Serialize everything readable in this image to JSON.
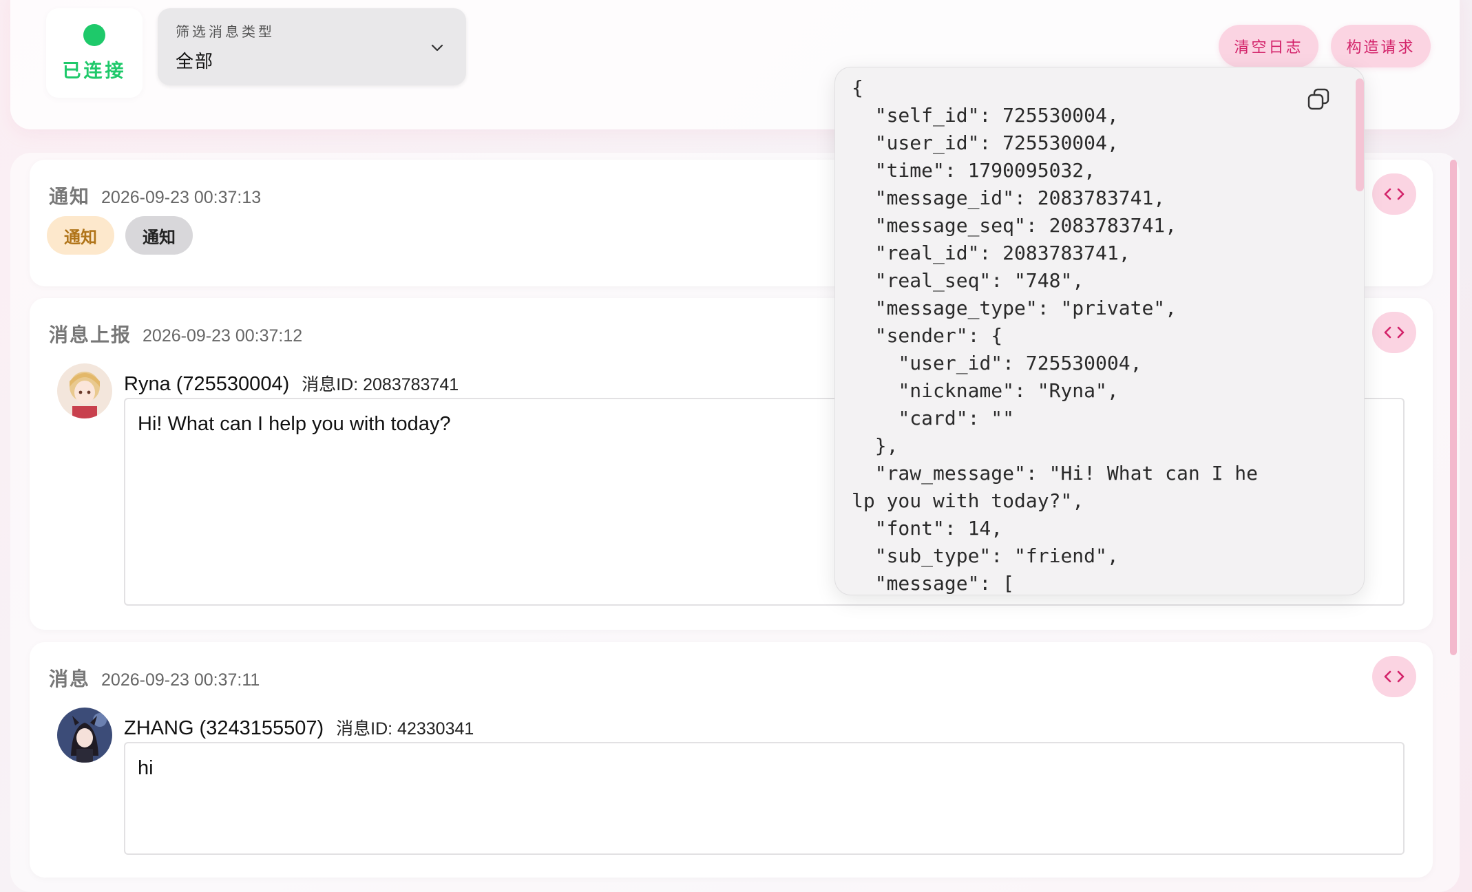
{
  "header": {
    "status": "已连接",
    "filter": {
      "label": "筛选消息类型",
      "value": "全部"
    },
    "buttons": {
      "clear_log": "清空日志",
      "build_request": "构造请求"
    }
  },
  "colors": {
    "connected": "#1ec96a",
    "accent": "#d3236a",
    "accent_bg": "#fbd4e2",
    "tag_orange_bg": "#fde8cc",
    "tag_orange_text": "#b07419"
  },
  "entries": [
    {
      "type": "通知",
      "time": "2026-09-23 00:37:13",
      "tags": [
        "通知",
        "通知"
      ]
    },
    {
      "type": "消息上报",
      "time": "2026-09-23 00:37:12",
      "sender": "Ryna (725530004)",
      "message_id": "消息ID: 2083783741",
      "content": "Hi! What can I help you with today?"
    },
    {
      "type": "消息",
      "time": "2026-09-23 00:37:11",
      "sender": "ZHANG (3243155507)",
      "message_id": "消息ID: 42330341",
      "content": "hi"
    }
  ],
  "json_popover": {
    "text": "{\n  \"self_id\": 725530004,\n  \"user_id\": 725530004,\n  \"time\": 1790095032,\n  \"message_id\": 2083783741,\n  \"message_seq\": 2083783741,\n  \"real_id\": 2083783741,\n  \"real_seq\": \"748\",\n  \"message_type\": \"private\",\n  \"sender\": {\n    \"user_id\": 725530004,\n    \"nickname\": \"Ryna\",\n    \"card\": \"\"\n  },\n  \"raw_message\": \"Hi! What can I he\nlp you with today?\",\n  \"font\": 14,\n  \"sub_type\": \"friend\",\n  \"message\": ["
  },
  "icons": {
    "status": "status-dot-icon",
    "filter": "chevron-down-icon",
    "code": "code-icon",
    "copy": "copy-icon"
  }
}
